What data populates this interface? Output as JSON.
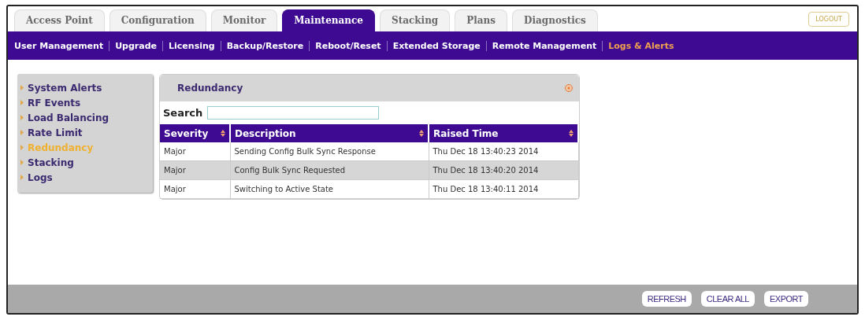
{
  "tabs": [
    {
      "label": "Access Point",
      "selected": false
    },
    {
      "label": "Configuration",
      "selected": false
    },
    {
      "label": "Monitor",
      "selected": false
    },
    {
      "label": "Maintenance",
      "selected": true
    },
    {
      "label": "Stacking",
      "selected": false
    },
    {
      "label": "Plans",
      "selected": false
    },
    {
      "label": "Diagnostics",
      "selected": false
    }
  ],
  "logout_button": "LOGOUT",
  "subnav": [
    {
      "label": "User Management",
      "selected": false
    },
    {
      "label": "Upgrade",
      "selected": false
    },
    {
      "label": "Licensing",
      "selected": false
    },
    {
      "label": "Backup/Restore",
      "selected": false
    },
    {
      "label": "Reboot/Reset",
      "selected": false
    },
    {
      "label": "Extended Storage",
      "selected": false
    },
    {
      "label": "Remote Management",
      "selected": false
    },
    {
      "label": "Logs & Alerts",
      "selected": true
    }
  ],
  "sidebar": {
    "items": [
      {
        "label": "System Alerts",
        "selected": false
      },
      {
        "label": "RF Events",
        "selected": false
      },
      {
        "label": "Load Balancing",
        "selected": false
      },
      {
        "label": "Rate Limit",
        "selected": false
      },
      {
        "label": "Redundancy",
        "selected": true
      },
      {
        "label": "Stacking",
        "selected": false
      },
      {
        "label": "Logs",
        "selected": false
      }
    ]
  },
  "panel": {
    "title": "Redundancy",
    "search_label": "Search",
    "table": {
      "columns": [
        "Severity",
        "Description",
        "Raised Time"
      ],
      "rows": [
        {
          "cells": [
            "Major",
            "Sending Config Bulk Sync Response",
            "Thu Dec 18 13:40:23 2014"
          ],
          "selected": false
        },
        {
          "cells": [
            "Major",
            "Config Bulk Sync Requested",
            "Thu Dec 18 13:40:20 2014"
          ],
          "selected": true
        },
        {
          "cells": [
            "Major",
            "Switching to Active State",
            "Thu Dec 18 13:40:11 2014"
          ],
          "selected": false
        }
      ]
    }
  },
  "buttons": [
    "REFRESH",
    "CLEAR ALL",
    "EXPORT"
  ]
}
